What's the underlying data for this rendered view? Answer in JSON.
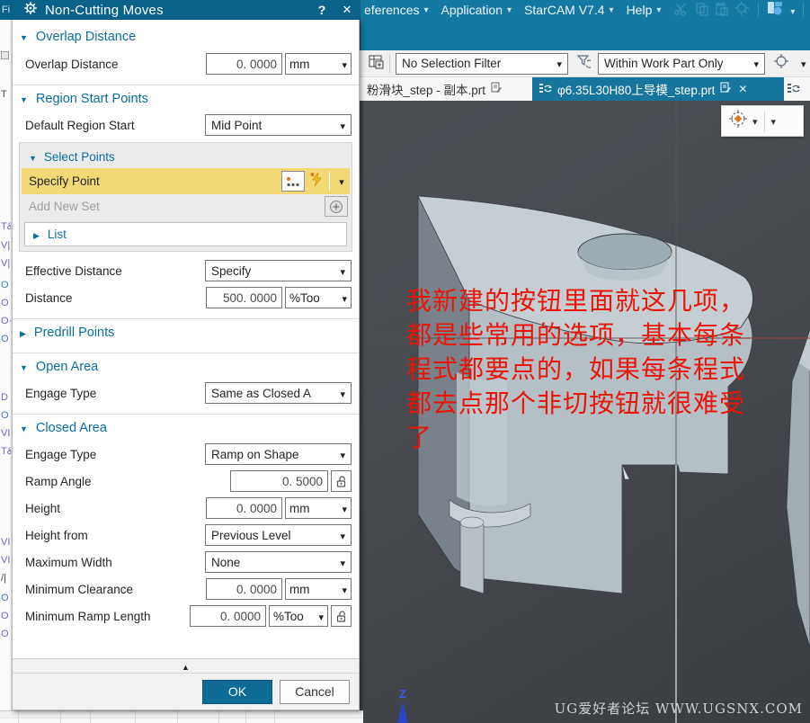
{
  "app": {
    "menu_fragment": "Fi",
    "menus": [
      "eferences",
      "Application",
      "StarCAM V7.4",
      "Help"
    ],
    "toolbar": {
      "selection_filter": "No Selection Filter",
      "scope": "Within Work Part Only"
    },
    "tabs": {
      "inactive": "粉滑块_step - 副本.prt",
      "active": "φ6.35L30H80上导模_step.prt",
      "close": "✕"
    }
  },
  "dialog": {
    "title": "Non-Cutting Moves",
    "help": "?",
    "close": "✕",
    "overlap": {
      "header": "Overlap Distance",
      "label": "Overlap Distance",
      "value": "0. 0000",
      "unit": "mm"
    },
    "region": {
      "header": "Region Start Points",
      "default_label": "Default Region Start",
      "default_value": "Mid Point"
    },
    "select_points": {
      "header": "Select Points",
      "specify": "Specify Point",
      "add_new_set": "Add New Set",
      "list": "List"
    },
    "effective": {
      "label": "Effective Distance",
      "value": "Specify"
    },
    "distance": {
      "label": "Distance",
      "value": "500. 0000",
      "unit": "%Too"
    },
    "predrill": {
      "header": "Predrill Points"
    },
    "open_area": {
      "header": "Open Area",
      "engage_label": "Engage Type",
      "engage_value": "Same as Closed A"
    },
    "closed_area": {
      "header": "Closed Area",
      "engage_label": "Engage Type",
      "engage_value": "Ramp on Shape",
      "ramp_angle_label": "Ramp Angle",
      "ramp_angle_value": "0. 5000",
      "height_label": "Height",
      "height_value": "0. 0000",
      "height_unit": "mm",
      "height_from_label": "Height from",
      "height_from_value": "Previous Level",
      "max_width_label": "Maximum Width",
      "max_width_value": "None",
      "min_clearance_label": "Minimum Clearance",
      "min_clearance_value": "0. 0000",
      "min_clearance_unit": "mm",
      "min_ramp_label": "Minimum Ramp Length",
      "min_ramp_value": "0. 0000",
      "min_ramp_unit": "%Too"
    },
    "ok": "OK",
    "cancel": "Cancel"
  },
  "viewport": {
    "annotation": [
      "我新建的按钮里面就这几项，",
      "都是些常用的选项，基本每条",
      "程式都要点的，如果每条程式",
      "都去点那个非切按钮就很难受",
      "了"
    ],
    "watermark": "UG爱好者论坛 WWW.UGSNX.COM",
    "axis_z": "Z"
  },
  "left_strip": [
    "T",
    "T&",
    "V|",
    "V|",
    "O",
    "O",
    "O·",
    "O",
    "D",
    "O",
    "VI",
    "T&",
    "VI",
    "VI",
    "/|",
    "O",
    "O",
    "O"
  ],
  "colors": {
    "accent_teal": "#0d6b95",
    "menu_teal": "#1478a3",
    "highlight_yellow": "#f3d876",
    "annotation_red": "#ea1508"
  }
}
